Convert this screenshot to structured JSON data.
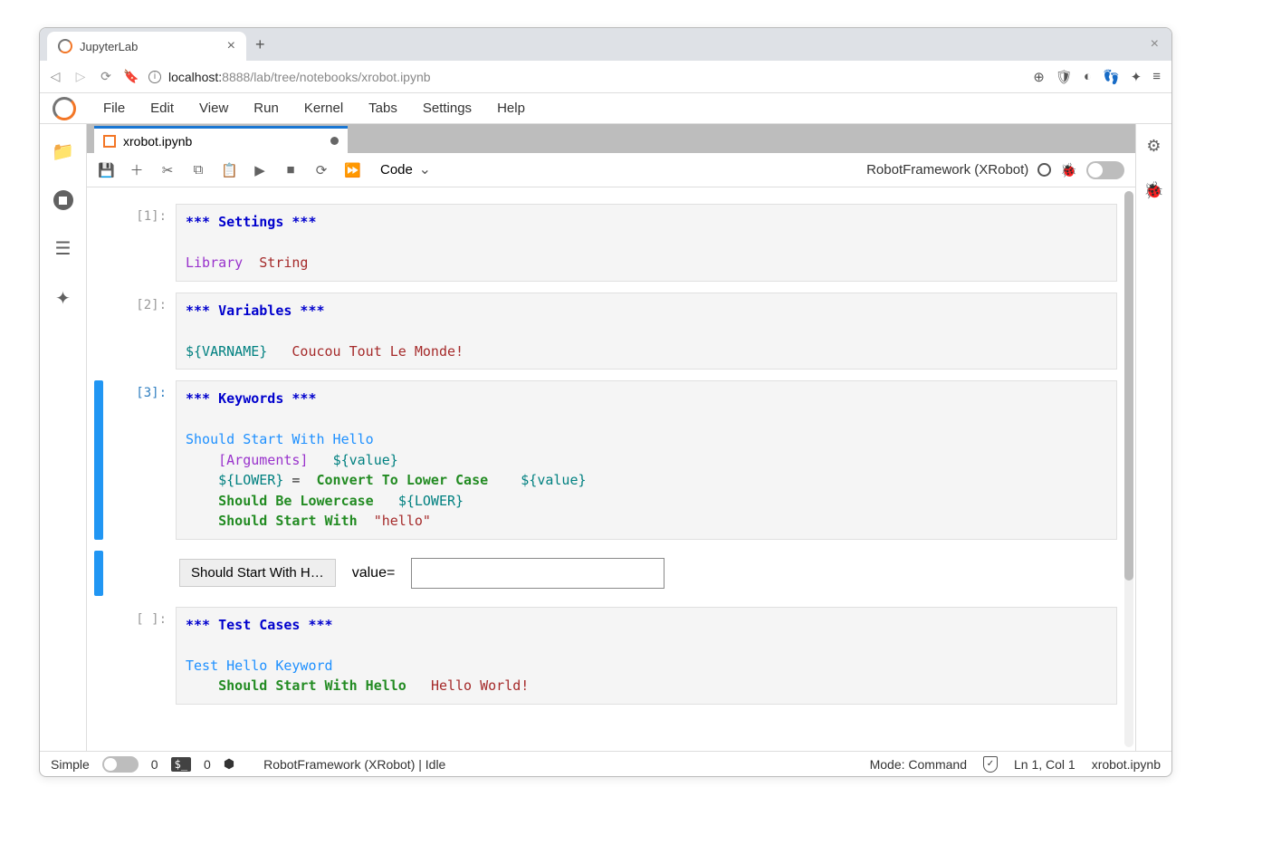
{
  "browser": {
    "tab_title": "JupyterLab",
    "url_host": "localhost:",
    "url_port_path": "8888/lab/tree/notebooks/xrobot.ipynb"
  },
  "menubar": [
    "File",
    "Edit",
    "View",
    "Run",
    "Kernel",
    "Tabs",
    "Settings",
    "Help"
  ],
  "doc_tab": {
    "filename": "xrobot.ipynb"
  },
  "toolbar": {
    "cell_type": "Code",
    "kernel_display": "RobotFramework (XRobot)"
  },
  "cells": [
    {
      "prompt": "[1]:",
      "tokens": [
        {
          "t": "*** ",
          "c": "kw-header"
        },
        {
          "t": "Settings",
          "c": "kw-header"
        },
        {
          "t": " ***",
          "c": "kw-header"
        },
        {
          "t": "\n\n"
        },
        {
          "t": "Library",
          "c": "kw-lib"
        },
        {
          "t": "  "
        },
        {
          "t": "String",
          "c": "kw-str"
        }
      ]
    },
    {
      "prompt": "[2]:",
      "tokens": [
        {
          "t": "*** ",
          "c": "kw-header"
        },
        {
          "t": "Variables",
          "c": "kw-header"
        },
        {
          "t": " ***",
          "c": "kw-header"
        },
        {
          "t": "\n\n"
        },
        {
          "t": "${VARNAME}",
          "c": "kw-var"
        },
        {
          "t": "   "
        },
        {
          "t": "Coucou Tout Le Monde!",
          "c": "kw-str"
        }
      ]
    },
    {
      "prompt": "[3]:",
      "active": true,
      "tokens": [
        {
          "t": "*** ",
          "c": "kw-header"
        },
        {
          "t": "Keywords",
          "c": "kw-header"
        },
        {
          "t": " ***",
          "c": "kw-header"
        },
        {
          "t": "\n\n"
        },
        {
          "t": "Should Start With Hello",
          "c": "kw-name"
        },
        {
          "t": "\n    "
        },
        {
          "t": "[Arguments]",
          "c": "kw-arg"
        },
        {
          "t": "   "
        },
        {
          "t": "${value}",
          "c": "kw-var"
        },
        {
          "t": "\n    "
        },
        {
          "t": "${LOWER}",
          "c": "kw-var"
        },
        {
          "t": " =  "
        },
        {
          "t": "Convert To Lower Case",
          "c": "kw-call"
        },
        {
          "t": "    "
        },
        {
          "t": "${value}",
          "c": "kw-var"
        },
        {
          "t": "\n    "
        },
        {
          "t": "Should Be Lowercase",
          "c": "kw-call"
        },
        {
          "t": "   "
        },
        {
          "t": "${LOWER}",
          "c": "kw-var"
        },
        {
          "t": "\n    "
        },
        {
          "t": "Should Start With",
          "c": "kw-call"
        },
        {
          "t": "  "
        },
        {
          "t": "\"hello\"",
          "c": "kw-str"
        }
      ],
      "output": {
        "button": "Should Start With H…",
        "label": "value=",
        "input": ""
      }
    },
    {
      "prompt": "[ ]:",
      "tokens": [
        {
          "t": "*** ",
          "c": "kw-header"
        },
        {
          "t": "Test Cases",
          "c": "kw-header"
        },
        {
          "t": " ***",
          "c": "kw-header"
        },
        {
          "t": "\n\n"
        },
        {
          "t": "Test Hello Keyword",
          "c": "kw-name"
        },
        {
          "t": "\n    "
        },
        {
          "t": "Should Start With Hello",
          "c": "kw-call"
        },
        {
          "t": "   "
        },
        {
          "t": "Hello World!",
          "c": "kw-str"
        }
      ]
    }
  ],
  "statusbar": {
    "simple": "Simple",
    "left_num1": "0",
    "left_num2": "0",
    "kernel_status": "RobotFramework (XRobot) | Idle",
    "mode": "Mode: Command",
    "cursor": "Ln 1, Col 1",
    "filename": "xrobot.ipynb"
  }
}
